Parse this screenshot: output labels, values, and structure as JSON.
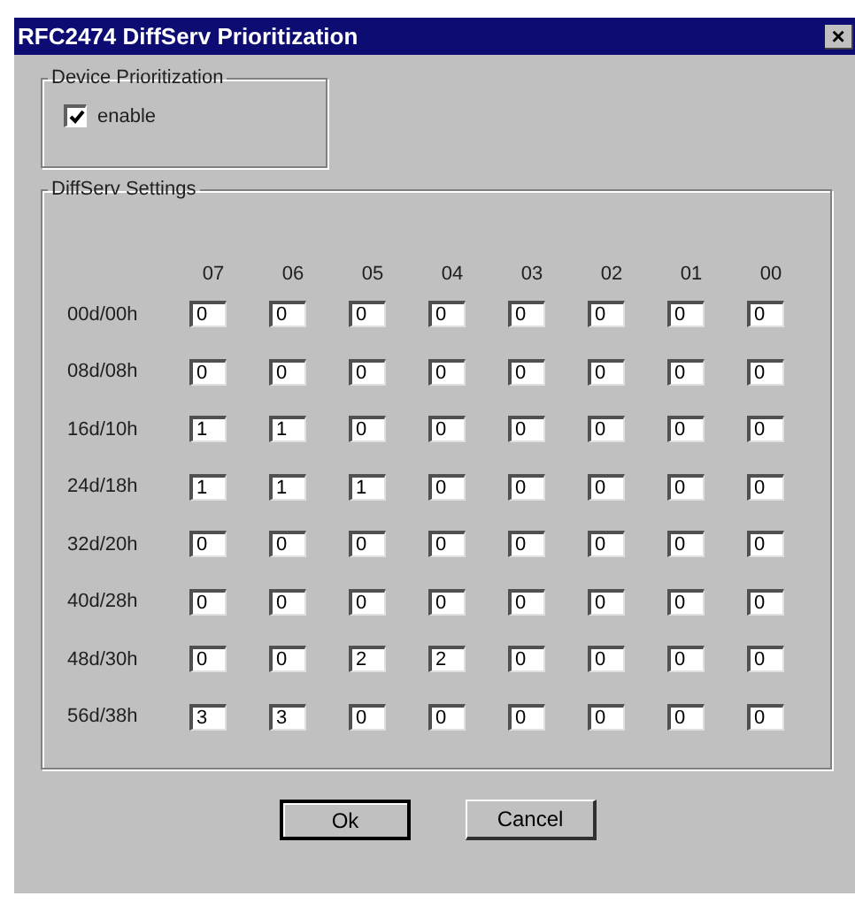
{
  "window": {
    "title": "RFC2474 DiffServ Prioritization",
    "close": "×"
  },
  "device_group": {
    "title": "Device Prioritization",
    "checkbox": {
      "label": "enable",
      "checked": true
    }
  },
  "settings_group": {
    "title": "DiffServ Settings",
    "columns": [
      "07",
      "06",
      "05",
      "04",
      "03",
      "02",
      "01",
      "00"
    ],
    "rows": [
      {
        "label": "00d/00h",
        "values": [
          "0",
          "0",
          "0",
          "0",
          "0",
          "0",
          "0",
          "0"
        ]
      },
      {
        "label": "08d/08h",
        "values": [
          "0",
          "0",
          "0",
          "0",
          "0",
          "0",
          "0",
          "0"
        ]
      },
      {
        "label": "16d/10h",
        "values": [
          "1",
          "1",
          "0",
          "0",
          "0",
          "0",
          "0",
          "0"
        ]
      },
      {
        "label": "24d/18h",
        "values": [
          "1",
          "1",
          "1",
          "0",
          "0",
          "0",
          "0",
          "0"
        ]
      },
      {
        "label": "32d/20h",
        "values": [
          "0",
          "0",
          "0",
          "0",
          "0",
          "0",
          "0",
          "0"
        ]
      },
      {
        "label": "40d/28h",
        "values": [
          "0",
          "0",
          "0",
          "0",
          "0",
          "0",
          "0",
          "0"
        ]
      },
      {
        "label": "48d/30h",
        "values": [
          "0",
          "0",
          "2",
          "2",
          "0",
          "0",
          "0",
          "0"
        ]
      },
      {
        "label": "56d/38h",
        "values": [
          "3",
          "3",
          "0",
          "0",
          "0",
          "0",
          "0",
          "0"
        ]
      }
    ]
  },
  "buttons": [
    {
      "label": "Ok",
      "default": true
    },
    {
      "label": "Cancel",
      "default": false
    }
  ]
}
